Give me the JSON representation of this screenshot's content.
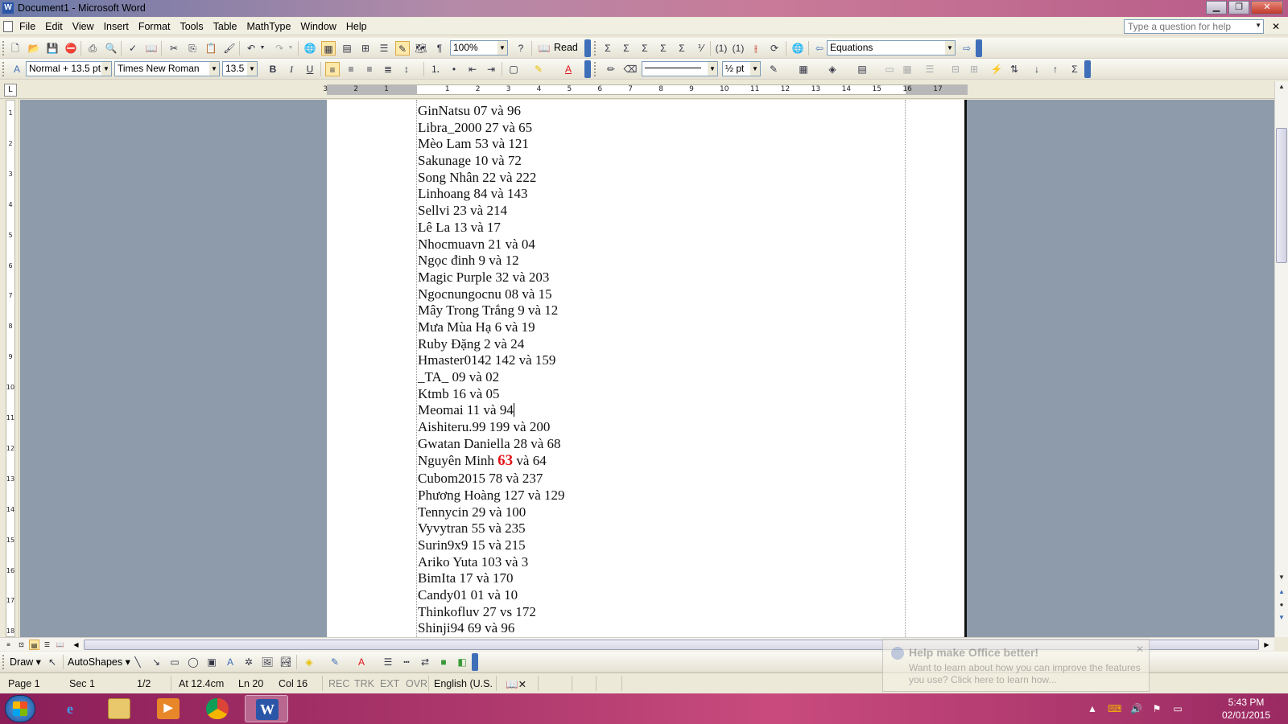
{
  "window": {
    "title": "Document1 - Microsoft Word"
  },
  "menu": {
    "items": [
      "File",
      "Edit",
      "View",
      "Insert",
      "Format",
      "Tools",
      "Table",
      "MathType",
      "Window",
      "Help"
    ]
  },
  "help_placeholder": "Type a question for help",
  "standard_toolbar": {
    "zoom": "100%",
    "read_label": "Read",
    "equations_label": "Equations"
  },
  "formatting_toolbar": {
    "style": "Normal + 13.5 pt",
    "font": "Times New Roman",
    "size": "13.5",
    "line_weight": "½ pt"
  },
  "ruler": {
    "ticks": [
      "3",
      "2",
      "1",
      "1",
      "2",
      "3",
      "4",
      "5",
      "6",
      "7",
      "8",
      "9",
      "10",
      "11",
      "12",
      "13",
      "14",
      "15",
      "16",
      "17"
    ]
  },
  "vruler": {
    "ticks": [
      "1",
      "2",
      "3",
      "4",
      "5",
      "6",
      "7",
      "8",
      "9",
      "10",
      "11",
      "12",
      "13",
      "14",
      "15",
      "16",
      "17",
      "18"
    ]
  },
  "document": {
    "lines": [
      "GinNatsu 07 và 96",
      "Libra_2000 27 và 65",
      "Mèo Lam 53 và 121",
      "Sakunage 10 và 72",
      "Song Nhân 22 và 222",
      "Linhoang 84 và 143",
      "Sellvi 23 và 214",
      "Lê La 13 và 17",
      "Nhocmuavn 21 và 04",
      "Ngọc đinh 9 và 12",
      "Magic Purple 32 và 203",
      "Ngocnungocnu 08 và 15",
      "Mây Trong Trắng 9 và 12",
      "Mưa Mùa Hạ 6 và 19",
      "Ruby Đặng 2 và 24",
      "Hmaster0142 142 và 159",
      "_TA_ 09 và 02",
      "Ktmb 16 và 05",
      "Meomai 11 và 94",
      "Aishiteru.99 199 và 200",
      "Gwatan Daniella 28 và 68",
      "Nguyên Minh ",
      "Cubom2015 78 và 237",
      "Phương Hoàng 127 và 129",
      "Tennycin 29 và 100",
      "Vyvytran 55 và 235",
      "Surin9x9 15 và 215",
      "Ariko Yuta 103 và 3",
      "BimIta 17 và 170",
      "Candy01 01 và 10",
      "Thinkofluv 27 vs 172",
      "Shinji94 69 và 96"
    ],
    "highlight_number": "63",
    "highlight_suffix": " và 64",
    "highlight_color": "#e4141b"
  },
  "drawing_toolbar": {
    "draw_label": "Draw",
    "autoshapes_label": "AutoShapes"
  },
  "status": {
    "page": "Page 1",
    "sec": "Sec 1",
    "pages": "1/2",
    "at": "At 12.4cm",
    "ln": "Ln 20",
    "col": "Col 16",
    "rec": "REC",
    "trk": "TRK",
    "ext": "EXT",
    "ovr": "OVR",
    "language": "English (U.S."
  },
  "balloon": {
    "title": "Help make Office better!",
    "body": "Want to learn about how you can improve the features you use? Click here to learn how..."
  },
  "taskbar": {
    "time": "5:43 PM",
    "date": "02/01/2015"
  }
}
